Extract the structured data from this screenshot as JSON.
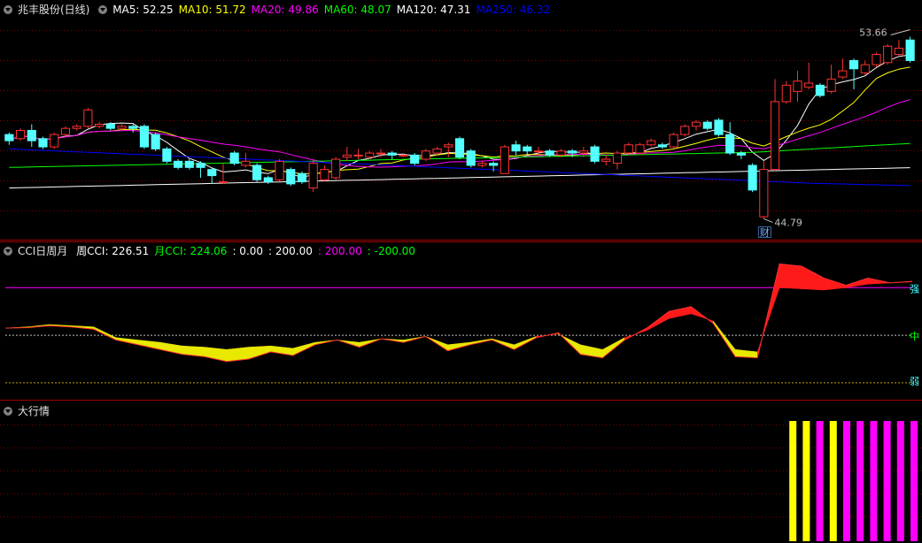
{
  "main_header": {
    "title": "兆丰股份(日线)",
    "ma": [
      {
        "label": "MA5: 52.25",
        "color": "#ffffff"
      },
      {
        "label": "MA10: 51.72",
        "color": "#ffff00"
      },
      {
        "label": "MA20: 49.86",
        "color": "#ff00ff"
      },
      {
        "label": "MA60: 48.07",
        "color": "#00ff00"
      },
      {
        "label": "MA120: 47.31",
        "color": "#ffffff"
      },
      {
        "label": "MA250: 46.32",
        "color": "#0000ff"
      }
    ]
  },
  "price_marks": {
    "high": "53.66",
    "low": "44.79",
    "event_badge": "财"
  },
  "cci_header": {
    "title": "CCI日周月",
    "items": [
      {
        "label": "周CCI: 226.51",
        "color": "#ffffff"
      },
      {
        "label": "月CCI: 224.06",
        "color": "#00ff00"
      },
      {
        "label": ": 0.00",
        "color": "#ffffff"
      },
      {
        "label": ": 200.00",
        "color": "#ffffff"
      },
      {
        "label": ": 200.00",
        "color": "#ff00ff"
      },
      {
        "label": ": -200.00",
        "color": "#00ff00"
      }
    ],
    "levels": {
      "strong": "强",
      "mid": "中",
      "weak": "弱"
    }
  },
  "trend_header": {
    "title": "大行情"
  },
  "colors": {
    "up": "#ff3232",
    "down": "#54ffff",
    "grid": "#7a0000"
  },
  "chart_data": [
    {
      "type": "candlestick",
      "title": "兆丰股份(日线)",
      "ylim": [
        44.0,
        54.5
      ],
      "candles": [
        [
          48.9,
          48.6,
          49.0,
          48.4
        ],
        [
          48.7,
          49.1,
          49.2,
          48.6
        ],
        [
          49.1,
          48.6,
          49.4,
          48.3
        ],
        [
          48.7,
          48.3,
          48.8,
          48.2
        ],
        [
          48.3,
          48.9,
          49.0,
          48.2
        ],
        [
          48.9,
          49.2,
          49.3,
          48.8
        ],
        [
          49.2,
          49.3,
          49.4,
          49.1
        ],
        [
          49.3,
          50.1,
          50.2,
          49.2
        ],
        [
          49.3,
          49.4,
          49.5,
          49.2
        ],
        [
          49.4,
          49.2,
          49.5,
          49.1
        ],
        [
          49.2,
          49.3,
          49.4,
          49.1
        ],
        [
          49.3,
          49.2,
          49.4,
          49.0
        ],
        [
          49.3,
          48.3,
          49.4,
          48.2
        ],
        [
          48.9,
          48.2,
          49.0,
          48.1
        ],
        [
          48.2,
          47.6,
          48.3,
          47.5
        ],
        [
          47.6,
          47.3,
          47.7,
          47.2
        ],
        [
          47.6,
          47.3,
          47.7,
          47.2
        ],
        [
          47.5,
          47.3,
          47.6,
          46.8
        ],
        [
          47.2,
          46.9,
          47.3,
          46.5
        ],
        [
          46.6,
          46.6,
          47.5,
          46.5
        ],
        [
          48.0,
          47.5,
          48.1,
          47.4
        ],
        [
          47.4,
          47.6,
          48.0,
          47.3
        ],
        [
          47.4,
          46.7,
          47.5,
          46.6
        ],
        [
          46.8,
          46.6,
          46.9,
          46.5
        ],
        [
          46.7,
          47.6,
          47.7,
          46.6
        ],
        [
          47.2,
          46.5,
          47.3,
          46.4
        ],
        [
          47.0,
          46.6,
          47.1,
          46.5
        ],
        [
          46.3,
          47.5,
          47.7,
          46.1
        ],
        [
          46.7,
          47.2,
          47.4,
          46.6
        ],
        [
          46.8,
          47.7,
          47.8,
          46.7
        ],
        [
          47.8,
          47.9,
          48.3,
          47.6
        ],
        [
          47.9,
          47.9,
          48.2,
          47.7
        ],
        [
          47.8,
          48.0,
          48.1,
          47.7
        ],
        [
          48.0,
          48.0,
          48.2,
          47.8
        ],
        [
          48.0,
          47.9,
          48.1,
          47.7
        ],
        [
          47.9,
          47.9,
          48.0,
          47.8
        ],
        [
          47.9,
          47.5,
          48.0,
          47.4
        ],
        [
          47.7,
          48.1,
          48.2,
          47.6
        ],
        [
          48.0,
          48.2,
          48.3,
          47.9
        ],
        [
          48.3,
          48.4,
          48.5,
          47.8
        ],
        [
          48.7,
          47.8,
          48.8,
          47.7
        ],
        [
          48.1,
          47.4,
          48.2,
          47.3
        ],
        [
          47.4,
          47.5,
          47.6,
          47.3
        ],
        [
          47.5,
          47.4,
          47.6,
          47.1
        ],
        [
          47.0,
          48.3,
          48.4,
          47.0
        ],
        [
          48.4,
          48.1,
          48.6,
          47.9
        ],
        [
          48.3,
          48.1,
          48.4,
          47.9
        ],
        [
          48.1,
          48.1,
          48.3,
          47.9
        ],
        [
          48.1,
          47.9,
          48.2,
          47.8
        ],
        [
          47.9,
          48.1,
          48.2,
          47.8
        ],
        [
          48.1,
          48.0,
          48.2,
          47.8
        ],
        [
          48.0,
          48.1,
          48.3,
          47.8
        ],
        [
          48.3,
          47.6,
          48.4,
          47.5
        ],
        [
          47.6,
          47.7,
          47.9,
          47.4
        ],
        [
          47.5,
          48.0,
          48.1,
          47.2
        ],
        [
          48.0,
          48.4,
          48.5,
          47.9
        ],
        [
          48.0,
          48.4,
          48.5,
          47.9
        ],
        [
          48.4,
          48.6,
          48.7,
          48.3
        ],
        [
          48.4,
          48.3,
          48.5,
          48.2
        ],
        [
          48.3,
          48.9,
          49.0,
          48.2
        ],
        [
          48.9,
          49.3,
          49.4,
          48.8
        ],
        [
          49.3,
          49.5,
          49.6,
          49.1
        ],
        [
          49.5,
          49.2,
          49.6,
          49.1
        ],
        [
          49.6,
          48.9,
          49.7,
          48.8
        ],
        [
          48.9,
          48.0,
          49.5,
          47.9
        ],
        [
          48.0,
          47.9,
          48.1,
          47.7
        ],
        [
          47.4,
          46.2,
          47.5,
          46.1
        ],
        [
          44.9,
          47.2,
          47.6,
          44.8
        ],
        [
          47.2,
          50.5,
          51.6,
          47.1
        ],
        [
          50.5,
          51.3,
          51.5,
          50.4
        ],
        [
          51.0,
          51.5,
          52.0,
          50.5
        ],
        [
          51.2,
          51.4,
          52.4,
          51.1
        ],
        [
          51.3,
          50.8,
          51.4,
          50.7
        ],
        [
          51.0,
          51.6,
          52.3,
          50.9
        ],
        [
          51.7,
          52.0,
          52.6,
          51.6
        ],
        [
          52.5,
          52.1,
          52.6,
          51.1
        ],
        [
          51.9,
          52.3,
          52.5,
          51.8
        ],
        [
          52.3,
          52.8,
          52.9,
          52.2
        ],
        [
          52.4,
          53.2,
          53.3,
          52.3
        ],
        [
          52.8,
          53.1,
          53.5,
          52.7
        ],
        [
          53.5,
          52.5,
          53.66,
          52.4
        ]
      ]
    },
    {
      "type": "area",
      "title": "CCI日周月",
      "ylim": [
        -260,
        320
      ],
      "reference_lines": [
        200,
        0,
        -200
      ],
      "series": [
        {
          "name": "周CCI",
          "color": "#ffffff",
          "values": [
            30,
            32,
            40,
            35,
            25,
            -20,
            -40,
            -60,
            -80,
            -90,
            -110,
            -100,
            -70,
            -85,
            -40,
            -20,
            -50,
            -15,
            -30,
            -5,
            -65,
            -40,
            -20,
            -60,
            -10,
            10,
            -80,
            -95,
            -20,
            30,
            100,
            120,
            50,
            -90,
            -95,
            300,
            290,
            240,
            210,
            240,
            220,
            226.51
          ]
        },
        {
          "name": "月CCI",
          "color": "#00ff00",
          "values": [
            30,
            35,
            45,
            40,
            35,
            -10,
            -20,
            -30,
            -45,
            -50,
            -60,
            -50,
            -45,
            -55,
            -30,
            -20,
            -30,
            -15,
            -20,
            -5,
            -40,
            -30,
            -15,
            -40,
            -5,
            5,
            -40,
            -60,
            -10,
            20,
            70,
            90,
            60,
            -60,
            -70,
            200,
            195,
            190,
            200,
            215,
            220,
            224.06
          ]
        }
      ]
    },
    {
      "type": "bar",
      "title": "大行情",
      "values": [
        1,
        1,
        1,
        1,
        1,
        1,
        1,
        1,
        1,
        1
      ],
      "colors": [
        "#ffff00",
        "#ffff00",
        "#ff00ff",
        "#ffff00",
        "#ff00ff",
        "#ff00ff",
        "#ff00ff",
        "#ff00ff",
        "#ff00ff",
        "#ff00ff"
      ]
    }
  ]
}
